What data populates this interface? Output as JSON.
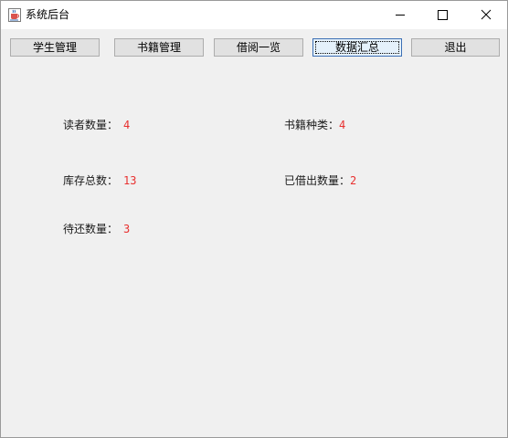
{
  "window": {
    "title": "系统后台"
  },
  "toolbar": {
    "buttons": [
      {
        "label": "学生管理"
      },
      {
        "label": "书籍管理"
      },
      {
        "label": "借阅一览"
      },
      {
        "label": "数据汇总"
      },
      {
        "label": "退出"
      }
    ]
  },
  "stats": {
    "reader_count": {
      "label": "读者数量：",
      "value": "4"
    },
    "book_types": {
      "label": "书籍种类：",
      "value": "4"
    },
    "stock_total": {
      "label": "库存总数：",
      "value": "13"
    },
    "borrowed_count": {
      "label": "已借出数量：",
      "value": "2"
    },
    "pending_return": {
      "label": "待还数量：",
      "value": "3"
    }
  },
  "colors": {
    "value_red": "#e8302f",
    "window_bg": "#f0f0f0",
    "button_bg": "#e1e1e1",
    "focus_border": "#3c6fb5"
  }
}
